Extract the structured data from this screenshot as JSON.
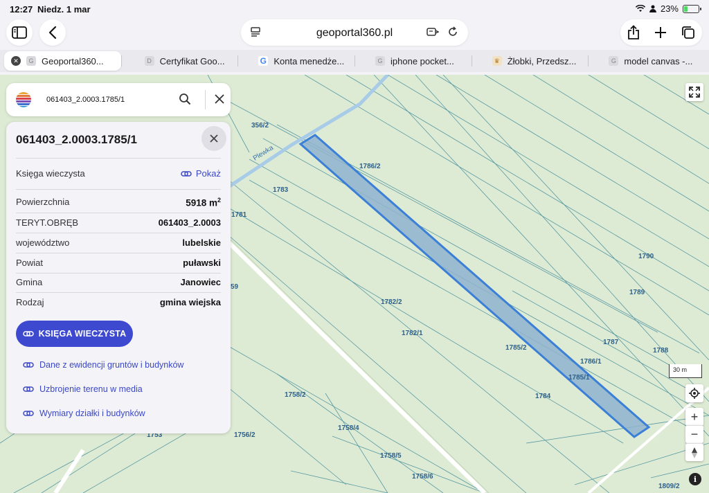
{
  "status_bar": {
    "time": "12:27",
    "date": "Niedz. 1 mar",
    "battery": "23%",
    "battery_level": 0.23
  },
  "browser": {
    "url": "geoportal360.pl",
    "tabs": [
      {
        "label": "Geoportal360...",
        "active": true
      },
      {
        "label": "Certyfikat Goo..."
      },
      {
        "label": "Konta menedże..."
      },
      {
        "label": "iphone pocket..."
      },
      {
        "label": "Żłobki, Przedsz..."
      },
      {
        "label": "model canvas -..."
      }
    ]
  },
  "search": {
    "query": "061403_2.0003.1785/1"
  },
  "panel": {
    "title": "061403_2.0003.1785/1",
    "ksiega": {
      "label": "Księga wieczysta",
      "action": "Pokaż"
    },
    "rows": [
      {
        "label": "Powierzchnia",
        "value": "5918 m",
        "sup": "2"
      },
      {
        "label": "TERYT.OBRĘB",
        "value": "061403_2.0003"
      },
      {
        "label": "województwo",
        "value": "lubelskie"
      },
      {
        "label": "Powiat",
        "value": "puławski"
      },
      {
        "label": "Gmina",
        "value": "Janowiec"
      },
      {
        "label": "Rodzaj",
        "value": "gmina wiejska"
      }
    ],
    "button_label": "KSIĘGA WIECZYSTA",
    "links": [
      "Dane z ewidencji gruntów i budynków",
      "Uzbrojenie terenu w media",
      "Wymiary działki i budynków"
    ]
  },
  "map": {
    "river_label": "Plewka",
    "scale": "30 m",
    "parcel_labels": [
      "356/2",
      "1786/2",
      "1783",
      "1781",
      "59",
      "1782/2",
      "1782/1",
      "1785/2",
      "1786/1",
      "1785/1",
      "1784",
      "1787",
      "1788",
      "1789",
      "1790",
      "1758/2",
      "1758/4",
      "1758/5",
      "1758/6",
      "1756/2",
      "1753",
      "1809/2"
    ],
    "colors": {
      "background": "#deebd4",
      "parcel_lines": "#3f8a9a",
      "selection_fill": "#8fb3cf",
      "selection_stroke": "#3b7fd6"
    }
  }
}
